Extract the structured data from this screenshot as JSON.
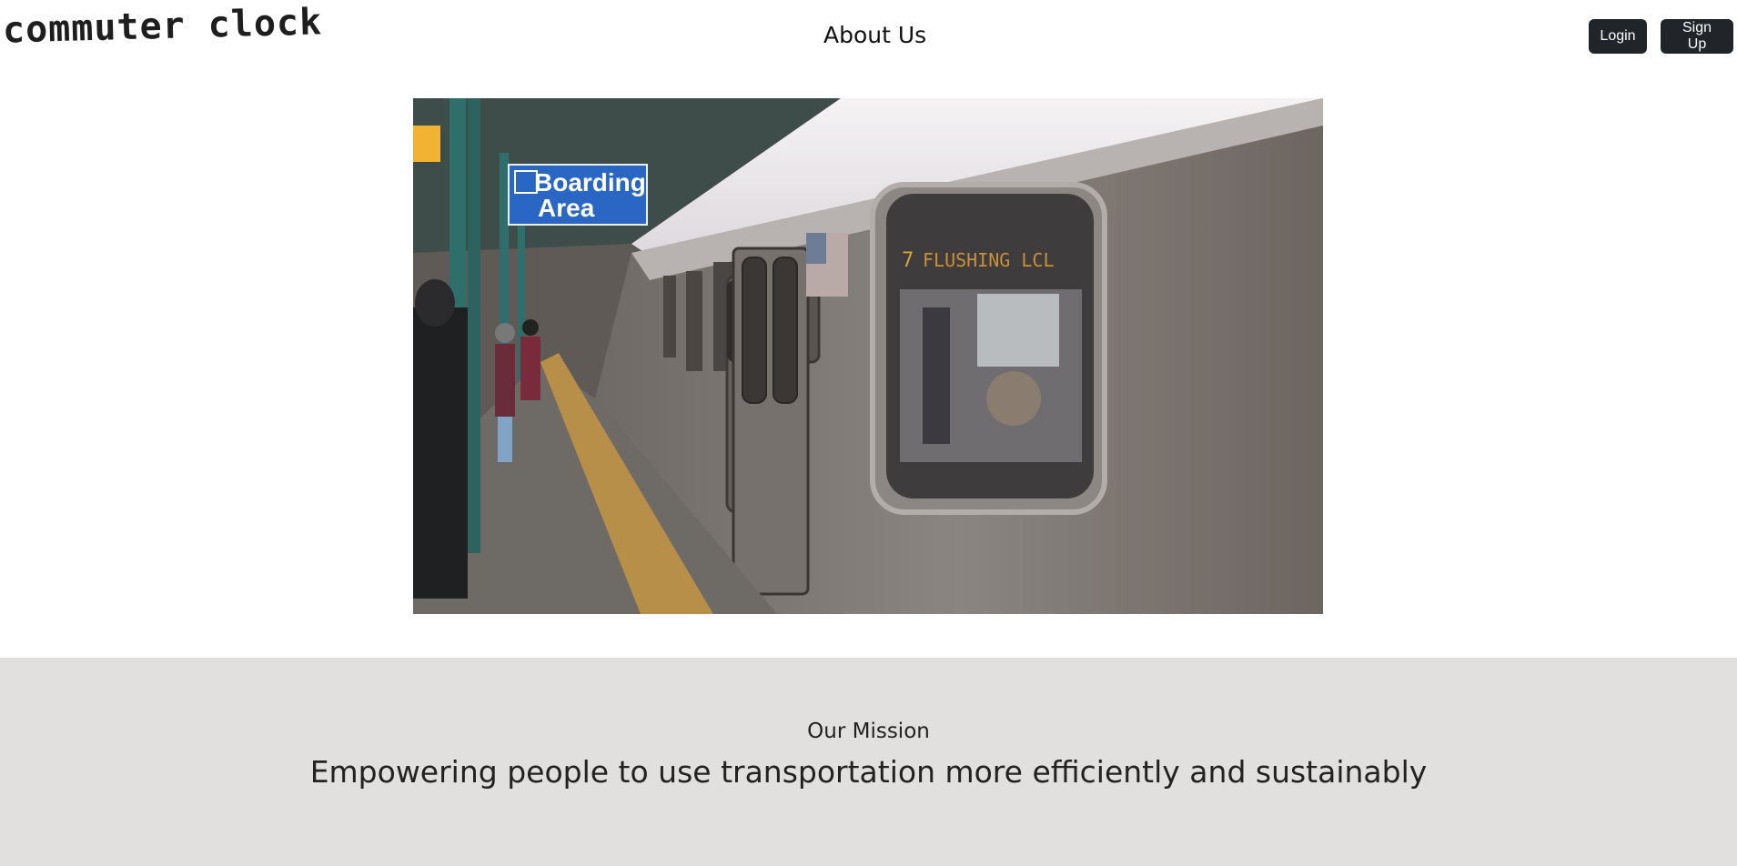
{
  "header": {
    "logo": "commuter clock",
    "nav": {
      "about": "About Us"
    },
    "buttons": {
      "login": "Login",
      "signup": "Sign Up"
    }
  },
  "hero": {
    "sign_line1": "Boarding",
    "sign_line2": "Area",
    "destination_sign": "FLUSHING LCL",
    "route_number": "7"
  },
  "mission": {
    "label": "Our Mission",
    "statement": "Empowering people to use transportation more efficiently and sustainably"
  },
  "colors": {
    "button_bg": "#212529",
    "mission_bg": "#e1e0de",
    "sign_blue": "#2a66c4"
  }
}
